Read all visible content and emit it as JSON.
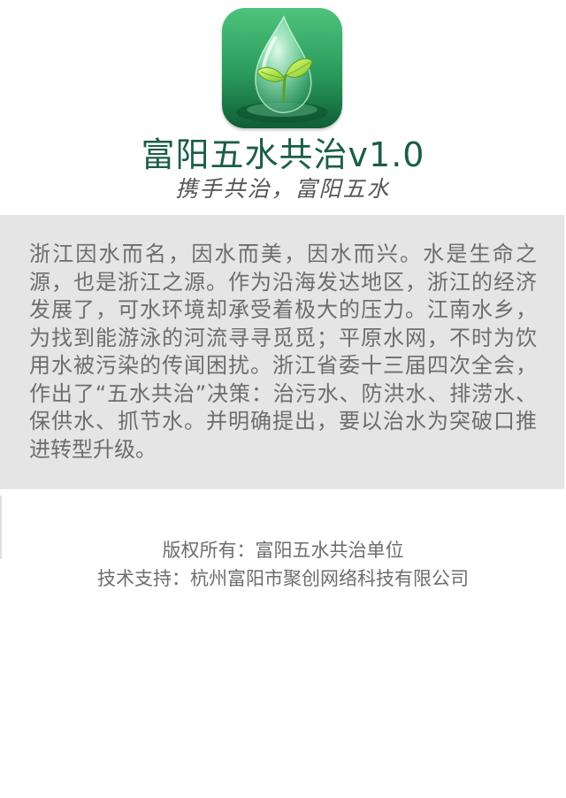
{
  "app": {
    "icon": "water-drop-leaf-icon",
    "title": "富阳五水共治v1.0",
    "slogan": "携手共治，富阳五水"
  },
  "intro": {
    "text": "浙江因水而名，因水而美，因水而兴。水是生命之源，也是浙江之源。作为沿海发达地区，浙江的经济发展了，可水环境却承受着极大的压力。江南水乡，为找到能游泳的河流寻寻觅觅；平原水网，不时为饮用水被污染的传闻困扰。浙江省委十三届四次全会，作出了“五水共治”决策：治污水、防洪水、排涝水、保供水、抓节水。并明确提出，要以治水为突破口推进转型升级。"
  },
  "footer": {
    "copyright": "版权所有：富阳五水共治单位",
    "support": "技术支持：杭州富阳市聚创网络科技有限公司"
  },
  "colors": {
    "title": "#1b5e47",
    "intro_background": "#e5e5e5",
    "body_text": "#6d6d6d",
    "icon_green": "#2e9e5f"
  }
}
